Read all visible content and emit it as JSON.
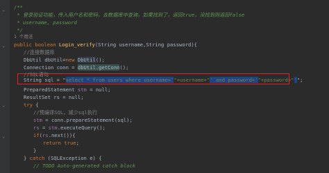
{
  "editor": {
    "lines": {
      "l1": "/**",
      "l2": " * 登录验证功能，传入用户名和密码，去数据库中查询，如果找到了，返回true，没找到则返回false",
      "l3": " * username, password",
      "l4": " */",
      "l5": "1 个用法",
      "l6a": "public boolean ",
      "l6b": "Login_verify",
      "l6c": "(String username,String password){",
      "l7": "//连接数据库",
      "l8a": "DbUtil dbUtil=",
      "l8b": "new ",
      "l8c": "DbUtil",
      "l8d": "();",
      "l9a": "Connection conn = ",
      "l9b": "dbUtil.getConn",
      "l9c": "();",
      "l10": "//SQL语句",
      "l11a": "String sql = \"",
      "l11b": "select * from users where username='",
      "l11c": "\"+username+\"",
      "l11d": "' and password='",
      "l11e": "\"+password+\"",
      "l11f": "'",
      "l11g": "\";",
      "l12a": "PreparedStatement ",
      "l12b": "stm",
      "l12c": " = null;",
      "l13": "ResultSet rs = null;",
      "l14a": "try",
      "l14b": " {",
      "l15": "//预编译SQL，减少sql执行",
      "l16a": "stm",
      "l16b": " = conn.prepareStatement(sql);",
      "l17a": "rs",
      "l17b": " = ",
      "l17c": "stm",
      "l17d": ".executeQuery();",
      "l18a": "if",
      "l18b": "(",
      "l18c": "rs",
      "l18d": ".next()){",
      "l19a": "return ",
      "l19b": "true",
      "l19c": ";",
      "l20": "}",
      "l21a": "} ",
      "l21b": "catch ",
      "l21c": "(SQLException e) {",
      "l22": "// TODO Auto-generated catch block"
    }
  },
  "colors": {
    "background": "#2b2b2b",
    "keyword": "#cc7832",
    "comment": "#808080",
    "javadoc": "#629755",
    "method": "#ffc66d",
    "string": "#6a8759",
    "field": "#9876aa",
    "highlight_box": "#e0232a"
  }
}
